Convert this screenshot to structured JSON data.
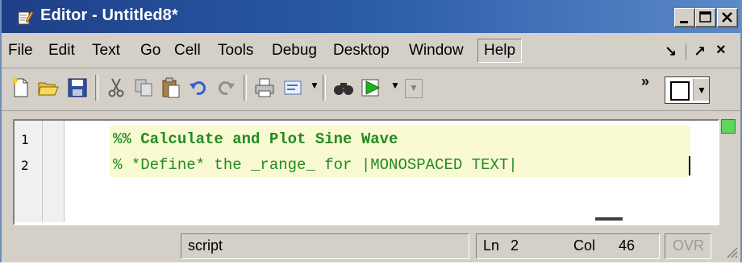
{
  "window": {
    "title": "Editor - Untitled8*",
    "controls": [
      "minimize-icon",
      "maximize-icon",
      "close-icon"
    ]
  },
  "menubar": {
    "items": [
      "File",
      "Edit",
      "Text",
      "Go",
      "Cell",
      "Tools",
      "Debug",
      "Desktop",
      "Window",
      "Help"
    ],
    "dock_symbols": [
      "↘",
      "↗",
      "×"
    ]
  },
  "toolbar": {
    "icons": [
      "new-file-icon",
      "open-folder-icon",
      "save-icon",
      "cut-icon",
      "copy-icon",
      "paste-icon",
      "undo-icon",
      "redo-icon",
      "print-icon",
      "comment-icon",
      "find-icon",
      "run-icon"
    ],
    "overflow": "»"
  },
  "editor": {
    "lines": [
      {
        "number": "1",
        "text": "%% Calculate and Plot Sine Wave"
      },
      {
        "number": "2",
        "text": "% *Define* the _range_ for |MONOSPACED TEXT|"
      }
    ],
    "colors": {
      "comment": "#228b22",
      "cell_highlight": "#fafad2"
    }
  },
  "status": {
    "mode": "script",
    "ln_label": "Ln",
    "ln_value": "2",
    "col_label": "Col",
    "col_value": "46",
    "ovr": "OVR"
  }
}
